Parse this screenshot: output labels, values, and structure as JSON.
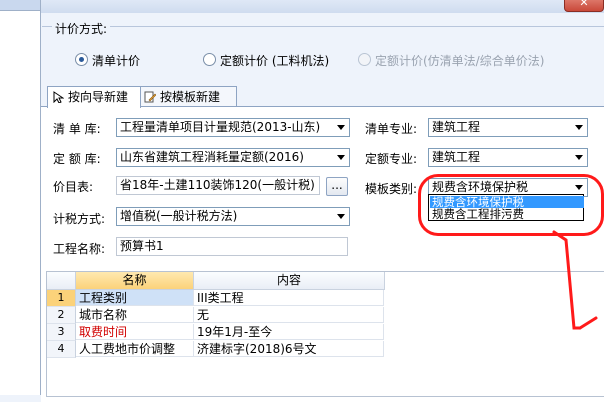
{
  "pricing": {
    "legend": "计价方式:",
    "options": [
      "清单计价",
      "定额计价 (工料机法)",
      "定额计价(仿清单法/综合单价法)"
    ]
  },
  "tabs": [
    "按向导新建",
    "按模板新建"
  ],
  "form": {
    "qingdan_ku_label": "清 单 库:",
    "qingdan_ku_value": "工程量清单项目计量规范(2013-山东)",
    "qingdan_zhuanye_label": "清单专业:",
    "qingdan_zhuanye_value": "建筑工程",
    "dinge_ku_label": "定 额 库:",
    "dinge_ku_value": "山东省建筑工程消耗量定额(2016)",
    "dinge_zhuanye_label": "定额专业:",
    "dinge_zhuanye_value": "建筑工程",
    "jiamu_label": "价目表:",
    "jiamu_value": "省18年-土建110装饰120(一般计税)",
    "jiamu_button": "...",
    "moban_label": "模板类别:",
    "moban_value": "规费含环境保护税",
    "moban_options": [
      "规费含环境保护税",
      "规费含工程排污费"
    ],
    "jishui_label": "计税方式:",
    "jishui_value": "增值税(一般计税方法)",
    "gongcheng_label": "工程名称:",
    "gongcheng_value": "预算书1"
  },
  "table": {
    "headers": [
      "名称",
      "内容"
    ],
    "rows": [
      {
        "num": "1",
        "name": "工程类别",
        "content": "III类工程"
      },
      {
        "num": "2",
        "name": "城市名称",
        "content": "无"
      },
      {
        "num": "3",
        "name": "取费时间",
        "content": "19年1月-至今"
      },
      {
        "num": "4",
        "name": "人工费地市价调整",
        "content": "济建标字(2018)6号文"
      }
    ]
  },
  "colors": {
    "accent": "#3399ff",
    "highlight_ring": "#ff1a1a",
    "red_text": "#d10000"
  }
}
